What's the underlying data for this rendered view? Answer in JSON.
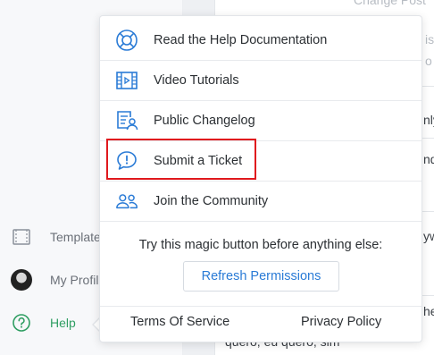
{
  "sidebar": {
    "items": [
      {
        "label": "Templates",
        "icon": "template-icon"
      },
      {
        "label": "My Profile",
        "icon": "avatar"
      },
      {
        "label": "Help",
        "icon": "question-circle-icon"
      }
    ]
  },
  "background": {
    "header": "Change Post",
    "muted_1": "is",
    "muted_2": "o",
    "frag_1": "nly",
    "frag_2": "nd",
    "frag_3": "yw",
    "frag_4": "he",
    "bottom_text": "quero, eu quero, sim"
  },
  "help_menu": {
    "items": [
      {
        "label": "Read the Help Documentation",
        "icon": "lifebuoy-icon"
      },
      {
        "label": "Video Tutorials",
        "icon": "film-icon"
      },
      {
        "label": "Public Changelog",
        "icon": "changelog-icon"
      },
      {
        "label": "Submit a Ticket",
        "icon": "chat-alert-icon"
      },
      {
        "label": "Join the Community",
        "icon": "community-icon"
      }
    ],
    "magic_text": "Try this magic button before anything else:",
    "refresh_label": "Refresh Permissions",
    "footer": {
      "terms": "Terms Of Service",
      "privacy": "Privacy Policy"
    }
  },
  "colors": {
    "accent": "#2a7bd6",
    "help_green": "#2f9e62",
    "highlight": "#e0191e"
  }
}
